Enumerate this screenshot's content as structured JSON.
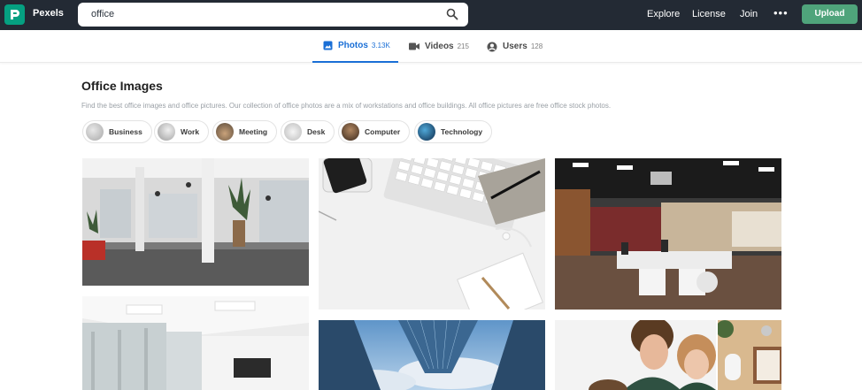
{
  "header": {
    "brand": "Pexels",
    "search_value": "office",
    "nav": {
      "explore": "Explore",
      "license": "License",
      "join": "Join",
      "more": "•••"
    },
    "upload": "Upload"
  },
  "tabs": [
    {
      "label": "Photos",
      "count": "3.13K",
      "active": true
    },
    {
      "label": "Videos",
      "count": "215",
      "active": false
    },
    {
      "label": "Users",
      "count": "128",
      "active": false
    }
  ],
  "page": {
    "title": "Office Images",
    "description": "Find the best office images and office pictures. Our collection of office photos are a mix of workstations and office buildings. All office pictures are free office stock photos."
  },
  "chips": [
    {
      "label": "Business"
    },
    {
      "label": "Work"
    },
    {
      "label": "Meeting"
    },
    {
      "label": "Desk"
    },
    {
      "label": "Computer"
    },
    {
      "label": "Technology"
    }
  ],
  "colors": {
    "header_bg": "#232a34",
    "brand_green": "#05a081",
    "upload_green": "#4fa47b",
    "active_tab": "#1a6fd6"
  }
}
